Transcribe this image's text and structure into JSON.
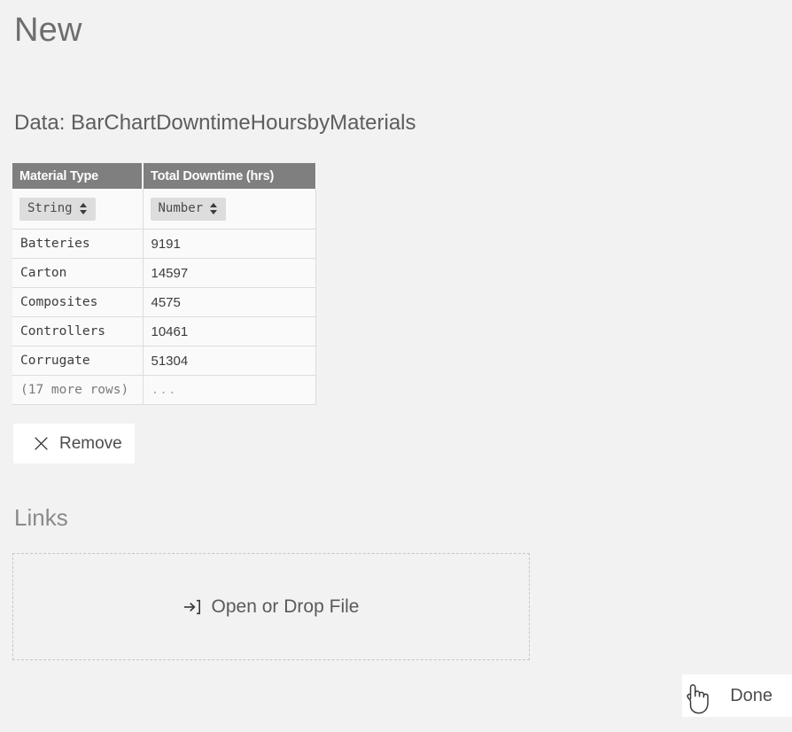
{
  "page": {
    "title": "New",
    "data_label": "Data: BarChartDowntimeHoursbyMaterials",
    "links_label": "Links"
  },
  "table": {
    "columns": [
      {
        "header": "Material Type",
        "type": "String"
      },
      {
        "header": "Total Downtime (hrs)",
        "type": "Number"
      }
    ],
    "rows": [
      {
        "material": "Batteries",
        "downtime": "9191"
      },
      {
        "material": "Carton",
        "downtime": "14597"
      },
      {
        "material": "Composites",
        "downtime": "4575"
      },
      {
        "material": "Controllers",
        "downtime": "10461"
      },
      {
        "material": "Corrugate",
        "downtime": "51304"
      }
    ],
    "more_rows_label": "(17 more rows)",
    "more_rows_value": "..."
  },
  "actions": {
    "remove_label": "Remove",
    "remove_icon": "close-x-icon",
    "drop_zone_label": "Open or Drop File",
    "drop_zone_icon": "import-arrow-icon",
    "done_label": "Done"
  },
  "cursor": {
    "icon": "pointing-hand-cursor"
  },
  "colors": {
    "background": "#f2f2f2",
    "table_header": "#7f7f7f",
    "table_header_text": "#ffffff",
    "type_chip": "#dddddd",
    "button_background": "#ffffff",
    "text": "#4d4d4d",
    "muted_text": "#8a8a8a",
    "drop_border": "#c6c6c6"
  }
}
